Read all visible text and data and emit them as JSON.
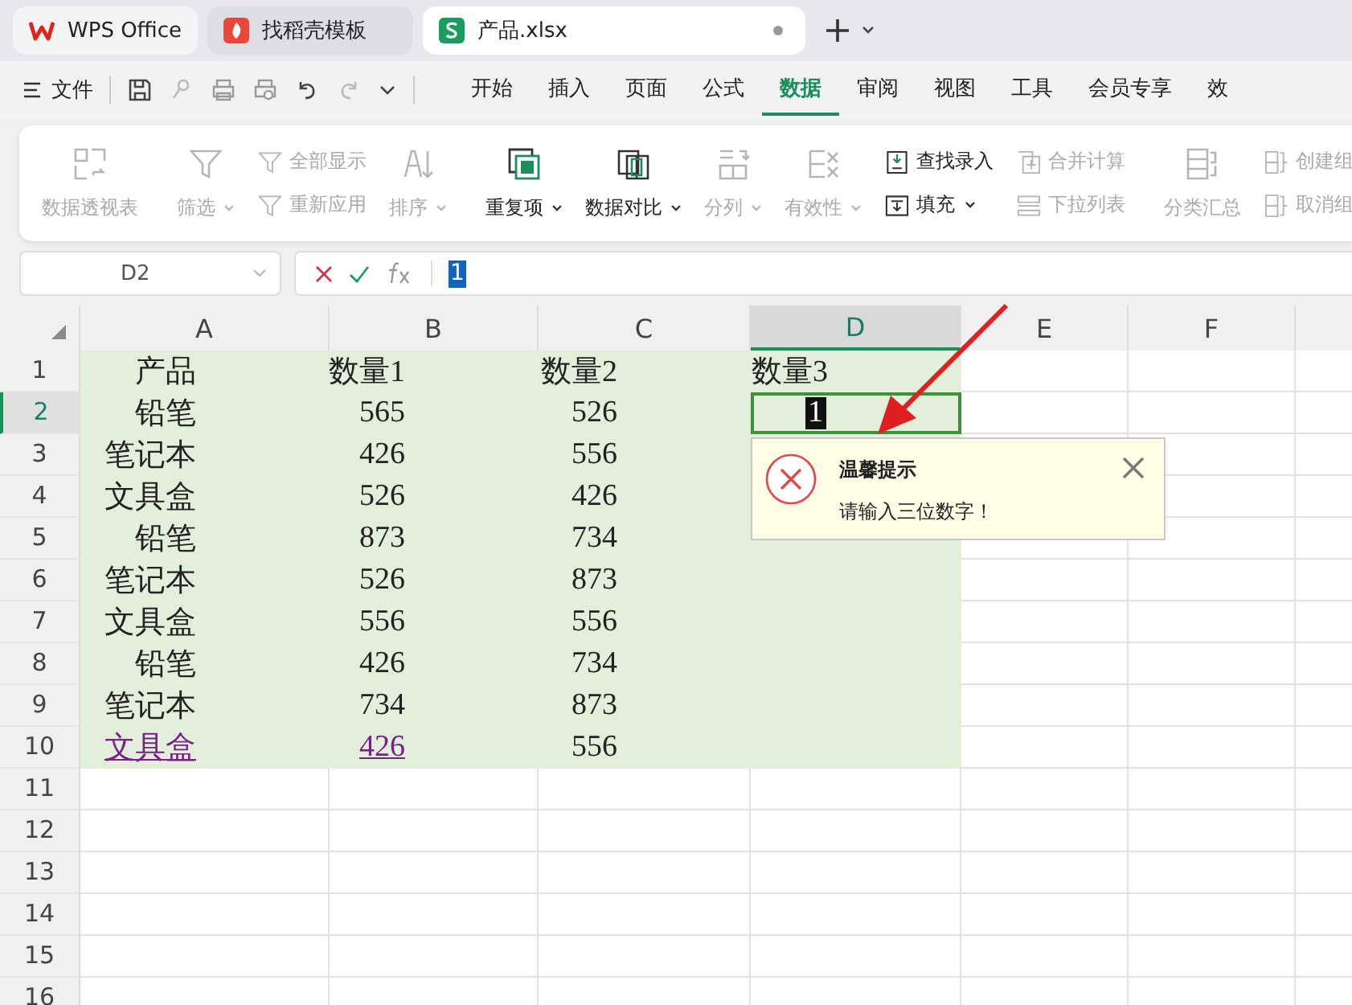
{
  "tabs": [
    {
      "label": "WPS Office",
      "kind": "wps",
      "selected": false,
      "unsaved": false
    },
    {
      "label": "找稻壳模板",
      "kind": "template",
      "selected": false,
      "unsaved": false
    },
    {
      "label": "产品.xlsx",
      "kind": "sheet",
      "selected": true,
      "unsaved": true
    }
  ],
  "file_menu": "文件",
  "ribbon_tabs": [
    {
      "label": "开始",
      "selected": false
    },
    {
      "label": "插入",
      "selected": false
    },
    {
      "label": "页面",
      "selected": false
    },
    {
      "label": "公式",
      "selected": false
    },
    {
      "label": "数据",
      "selected": true
    },
    {
      "label": "审阅",
      "selected": false
    },
    {
      "label": "视图",
      "selected": false
    },
    {
      "label": "工具",
      "selected": false
    },
    {
      "label": "会员专享",
      "selected": false
    },
    {
      "label": "效",
      "selected": false
    }
  ],
  "ribbon": [
    {
      "items": [
        {
          "kind": "large",
          "label": "数据透视表",
          "disabled": true,
          "dropdown": false
        }
      ]
    },
    {
      "items": [
        {
          "kind": "large",
          "label": "筛选",
          "disabled": true,
          "dropdown": true
        },
        {
          "kind": "stack",
          "items": [
            {
              "label": "全部显示",
              "disabled": true,
              "dropdown": false
            },
            {
              "label": "重新应用",
              "disabled": true,
              "dropdown": false
            }
          ]
        },
        {
          "kind": "large",
          "label": "排序",
          "disabled": true,
          "dropdown": true
        }
      ]
    },
    {
      "items": [
        {
          "kind": "large",
          "label": "重复项",
          "disabled": false,
          "dropdown": true
        },
        {
          "kind": "large",
          "label": "数据对比",
          "disabled": false,
          "dropdown": true
        },
        {
          "kind": "large",
          "label": "分列",
          "disabled": true,
          "dropdown": true
        },
        {
          "kind": "large",
          "label": "有效性",
          "disabled": true,
          "dropdown": true
        },
        {
          "kind": "stack",
          "items": [
            {
              "label": "查找录入",
              "disabled": false,
              "dropdown": false
            },
            {
              "label": "填充",
              "disabled": false,
              "dropdown": true
            }
          ]
        },
        {
          "kind": "stack",
          "items": [
            {
              "label": "合并计算",
              "disabled": true,
              "dropdown": false
            },
            {
              "label": "下拉列表",
              "disabled": true,
              "dropdown": false
            }
          ]
        }
      ]
    },
    {
      "items": [
        {
          "kind": "large",
          "label": "分类汇总",
          "disabled": true,
          "dropdown": false
        },
        {
          "kind": "stack",
          "items": [
            {
              "label": "创建组",
              "disabled": true,
              "dropdown": false
            },
            {
              "label": "取消组",
              "disabled": true,
              "dropdown": false
            }
          ]
        }
      ]
    }
  ],
  "name_box": "D2",
  "formula": "1",
  "sheet": {
    "columns": [
      {
        "label": "A",
        "selected": false,
        "shaded": true
      },
      {
        "label": "B",
        "selected": false,
        "shaded": true
      },
      {
        "label": "C",
        "selected": false,
        "shaded": true
      },
      {
        "label": "D",
        "selected": true,
        "shaded": true
      },
      {
        "label": "E",
        "selected": false,
        "shaded": false
      },
      {
        "label": "F",
        "selected": false,
        "shaded": false
      }
    ],
    "rows": [
      {
        "label": "1",
        "selected": false,
        "shaded": true,
        "cells": [
          {
            "text": "产品",
            "link": false,
            "editing": false
          },
          {
            "text": "数量1",
            "link": false,
            "editing": false
          },
          {
            "text": "数量2",
            "link": false,
            "editing": false
          },
          {
            "text": "数量3",
            "link": false,
            "editing": false
          }
        ]
      },
      {
        "label": "2",
        "selected": true,
        "shaded": true,
        "cells": [
          {
            "text": "铅笔",
            "link": false,
            "editing": false
          },
          {
            "text": "565",
            "link": false,
            "editing": false
          },
          {
            "text": "526",
            "link": false,
            "editing": false
          },
          {
            "text": "1",
            "link": false,
            "editing": true
          }
        ]
      },
      {
        "label": "3",
        "selected": false,
        "shaded": true,
        "cells": [
          {
            "text": "笔记本",
            "link": false,
            "editing": false
          },
          {
            "text": "426",
            "link": false,
            "editing": false
          },
          {
            "text": "556",
            "link": false,
            "editing": false
          }
        ]
      },
      {
        "label": "4",
        "selected": false,
        "shaded": true,
        "cells": [
          {
            "text": "文具盒",
            "link": false,
            "editing": false
          },
          {
            "text": "526",
            "link": false,
            "editing": false
          },
          {
            "text": "426",
            "link": false,
            "editing": false
          }
        ]
      },
      {
        "label": "5",
        "selected": false,
        "shaded": true,
        "cells": [
          {
            "text": "铅笔",
            "link": false,
            "editing": false
          },
          {
            "text": "873",
            "link": false,
            "editing": false
          },
          {
            "text": "734",
            "link": false,
            "editing": false
          }
        ]
      },
      {
        "label": "6",
        "selected": false,
        "shaded": true,
        "cells": [
          {
            "text": "笔记本",
            "link": false,
            "editing": false
          },
          {
            "text": "526",
            "link": false,
            "editing": false
          },
          {
            "text": "873",
            "link": false,
            "editing": false
          }
        ]
      },
      {
        "label": "7",
        "selected": false,
        "shaded": true,
        "cells": [
          {
            "text": "文具盒",
            "link": false,
            "editing": false
          },
          {
            "text": "556",
            "link": false,
            "editing": false
          },
          {
            "text": "556",
            "link": false,
            "editing": false
          }
        ]
      },
      {
        "label": "8",
        "selected": false,
        "shaded": true,
        "cells": [
          {
            "text": "铅笔",
            "link": false,
            "editing": false
          },
          {
            "text": "426",
            "link": false,
            "editing": false
          },
          {
            "text": "734",
            "link": false,
            "editing": false
          }
        ]
      },
      {
        "label": "9",
        "selected": false,
        "shaded": true,
        "cells": [
          {
            "text": "笔记本",
            "link": false,
            "editing": false
          },
          {
            "text": "734",
            "link": false,
            "editing": false
          },
          {
            "text": "873",
            "link": false,
            "editing": false
          }
        ]
      },
      {
        "label": "10",
        "selected": false,
        "shaded": true,
        "cells": [
          {
            "text": "文具盒",
            "link": true,
            "editing": false
          },
          {
            "text": "426",
            "link": true,
            "editing": false
          },
          {
            "text": "556",
            "link": false,
            "editing": false
          }
        ]
      },
      {
        "label": "11",
        "selected": false,
        "shaded": false,
        "cells": []
      },
      {
        "label": "12",
        "selected": false,
        "shaded": false,
        "cells": []
      },
      {
        "label": "13",
        "selected": false,
        "shaded": false,
        "cells": []
      },
      {
        "label": "14",
        "selected": false,
        "shaded": false,
        "cells": []
      },
      {
        "label": "15",
        "selected": false,
        "shaded": false,
        "cells": []
      },
      {
        "label": "16",
        "selected": false,
        "shaded": false,
        "cells": []
      }
    ]
  },
  "alert": {
    "title": "温馨提示",
    "message": "请输入三位数字！"
  }
}
